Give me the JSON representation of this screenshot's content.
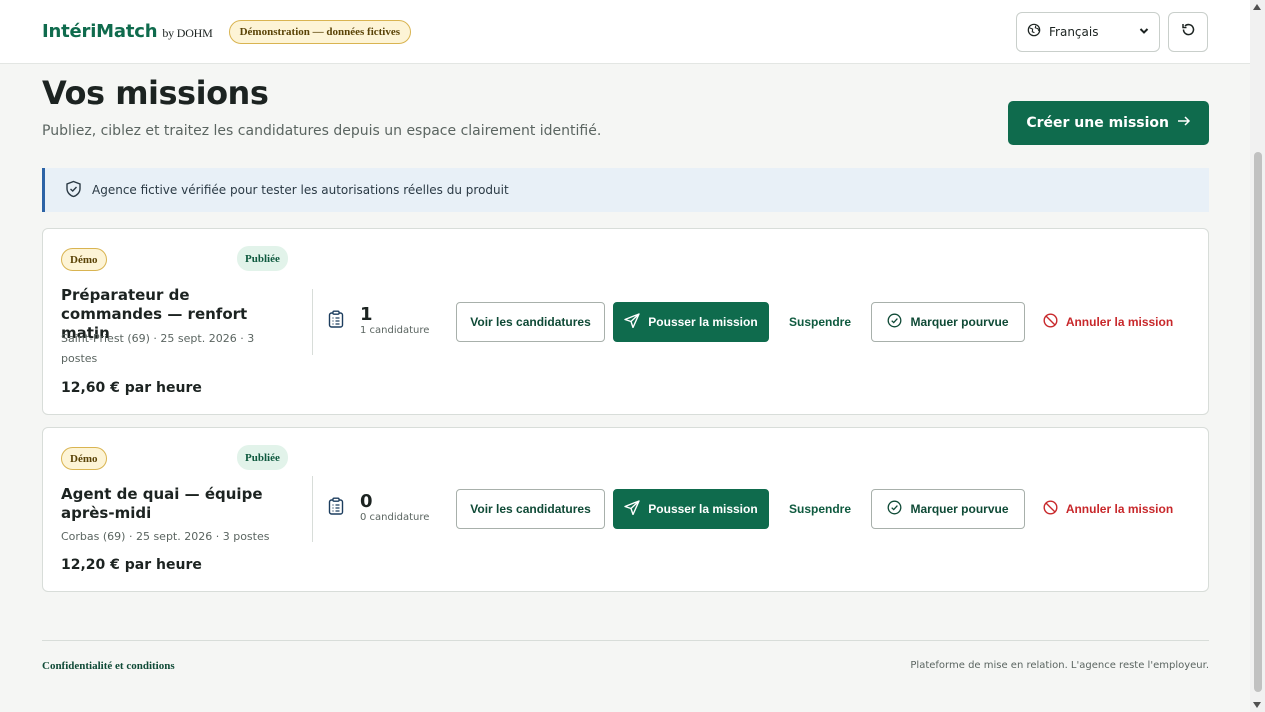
{
  "header": {
    "brand": "IntériMatch",
    "brand_by": "by DOHM",
    "demo_badge": "Démonstration — données fictives",
    "language": "Français"
  },
  "page": {
    "title": "Vos missions",
    "subtitle": "Publiez, ciblez et traitez les candidatures depuis un espace clairement identifié.",
    "create_button": "Créer une mission",
    "notice": "Agence fictive vérifiée pour tester les autorisations réelles du produit"
  },
  "missions": [
    {
      "demo_badge": "Démo",
      "status_badge": "Publiée",
      "title": "Préparateur de commandes — renfort matin",
      "meta": "Saint-Priest (69) · 25 sept. 2026 · 3 postes",
      "rate": "12,60 € par heure",
      "applications_count": "1",
      "applications_label": "1 candidature",
      "actions": {
        "view": "Voir les candidatures",
        "push": "Pousser la mission",
        "suspend": "Suspendre",
        "mark_filled": "Marquer pourvue",
        "cancel": "Annuler la mission"
      }
    },
    {
      "demo_badge": "Démo",
      "status_badge": "Publiée",
      "title": "Agent de quai — équipe après-midi",
      "meta": "Corbas (69) · 25 sept. 2026 · 3 postes",
      "rate": "12,20 € par heure",
      "applications_count": "0",
      "applications_label": "0 candidature",
      "actions": {
        "view": "Voir les candidatures",
        "push": "Pousser la mission",
        "suspend": "Suspendre",
        "mark_filled": "Marquer pourvue",
        "cancel": "Annuler la mission"
      }
    }
  ],
  "footer": {
    "link": "Confidentialité et conditions",
    "note": "Plateforme de mise en relation. L'agence reste l'employeur."
  },
  "colors": {
    "primary": "#0f6b4d",
    "danger": "#c8282b",
    "notice_border": "#2c63a6",
    "demo_badge_bg": "#fdf4d6"
  }
}
